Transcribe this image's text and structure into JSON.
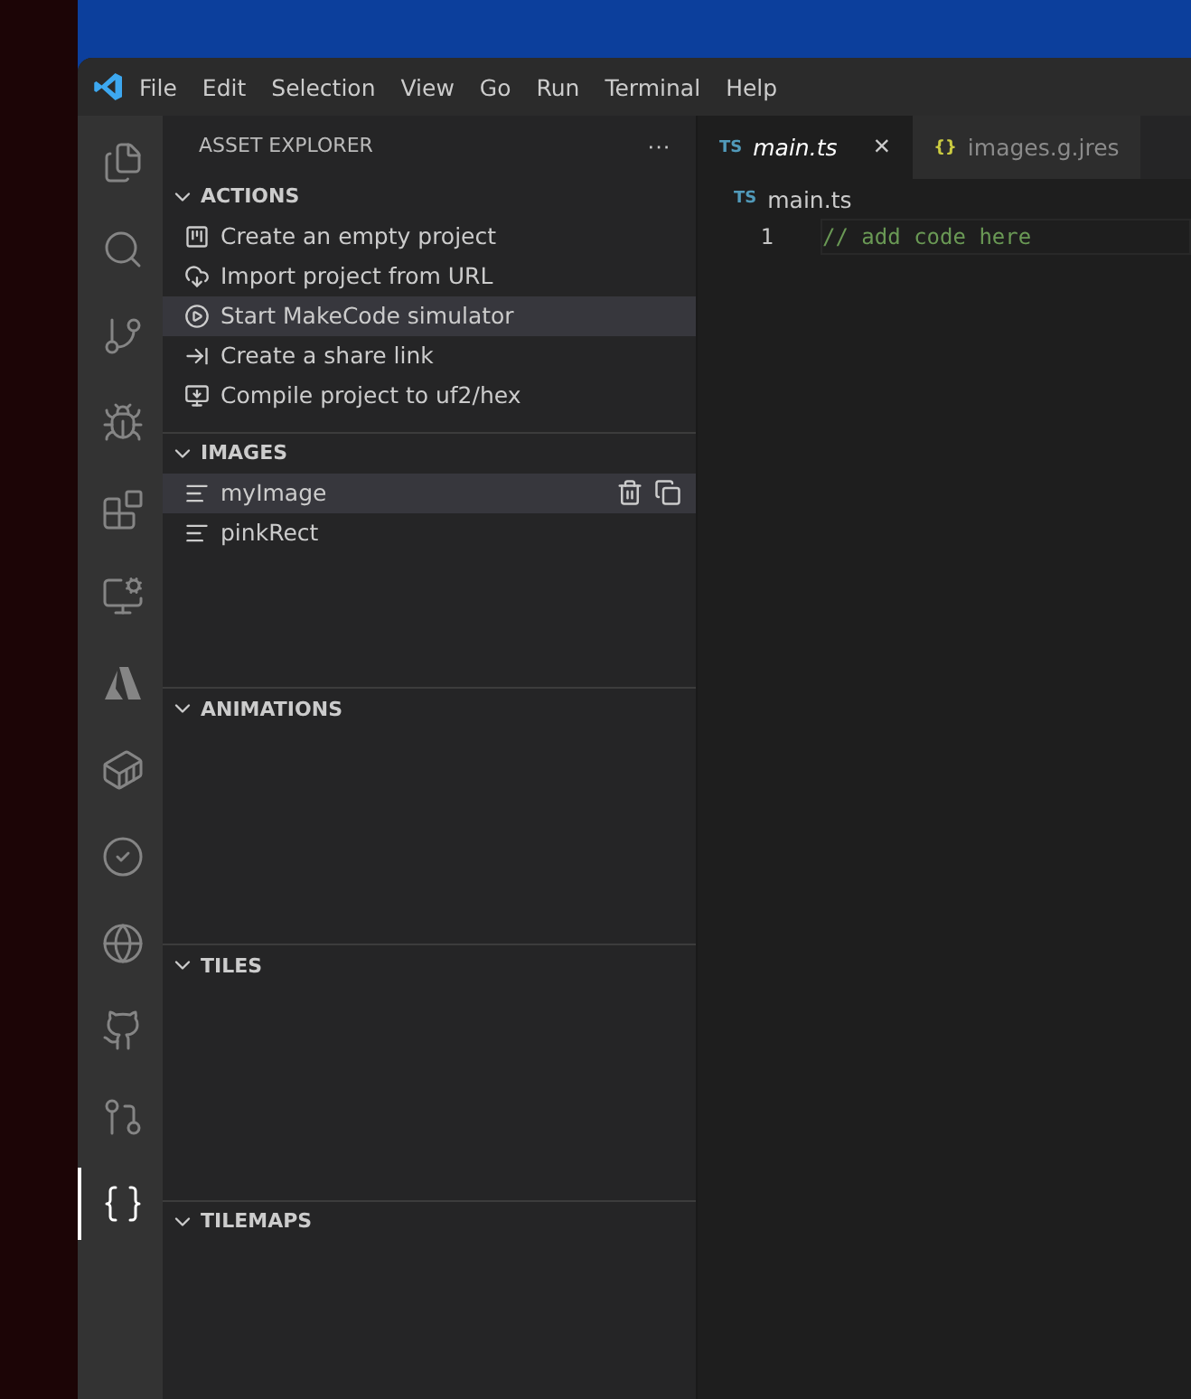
{
  "menu": [
    "File",
    "Edit",
    "Selection",
    "View",
    "Go",
    "Run",
    "Terminal",
    "Help"
  ],
  "activity": [
    {
      "kind": "files",
      "selected": false
    },
    {
      "kind": "search",
      "selected": false
    },
    {
      "kind": "git",
      "selected": false
    },
    {
      "kind": "debug",
      "selected": false
    },
    {
      "kind": "extensions",
      "selected": false
    },
    {
      "kind": "remote",
      "selected": false
    },
    {
      "kind": "azure",
      "selected": false
    },
    {
      "kind": "docker",
      "selected": false
    },
    {
      "kind": "check",
      "selected": false
    },
    {
      "kind": "edge",
      "selected": false
    },
    {
      "kind": "github",
      "selected": false
    },
    {
      "kind": "pr",
      "selected": false
    },
    {
      "kind": "makecode",
      "selected": true
    }
  ],
  "sidebar": {
    "title": "ASSET EXPLORER",
    "more": "···",
    "sections": [
      {
        "title": "ACTIONS",
        "expanded": true,
        "items": [
          {
            "label": "Create an empty project",
            "kind": "project",
            "selected": false
          },
          {
            "label": "Import project from URL",
            "kind": "cloud",
            "selected": false
          },
          {
            "label": "Start MakeCode simulator",
            "kind": "play",
            "selected": true
          },
          {
            "label": "Create a share link",
            "kind": "arrow",
            "selected": false
          },
          {
            "label": "Compile project to uf2/hex",
            "kind": "compile",
            "selected": false
          }
        ]
      },
      {
        "title": "IMAGES",
        "expanded": true,
        "items": [
          {
            "label": "myImage",
            "kind": "asset",
            "selected": true
          },
          {
            "label": "pinkRect",
            "kind": "asset",
            "selected": false
          }
        ]
      },
      {
        "title": "ANIMATIONS",
        "expanded": true
      },
      {
        "title": "TILES",
        "expanded": true
      },
      {
        "title": "TILEMAPS",
        "expanded": true
      }
    ]
  },
  "tabs": [
    {
      "badge": "TS",
      "label": "main.ts",
      "selected": true,
      "close": "×"
    },
    {
      "badge": "{}",
      "label": "images.g.jres",
      "selected": false
    }
  ],
  "breadcrumb": {
    "badge": "TS",
    "label": "main.ts"
  },
  "lines": [
    {
      "number": "1",
      "code": "// add code here"
    }
  ]
}
